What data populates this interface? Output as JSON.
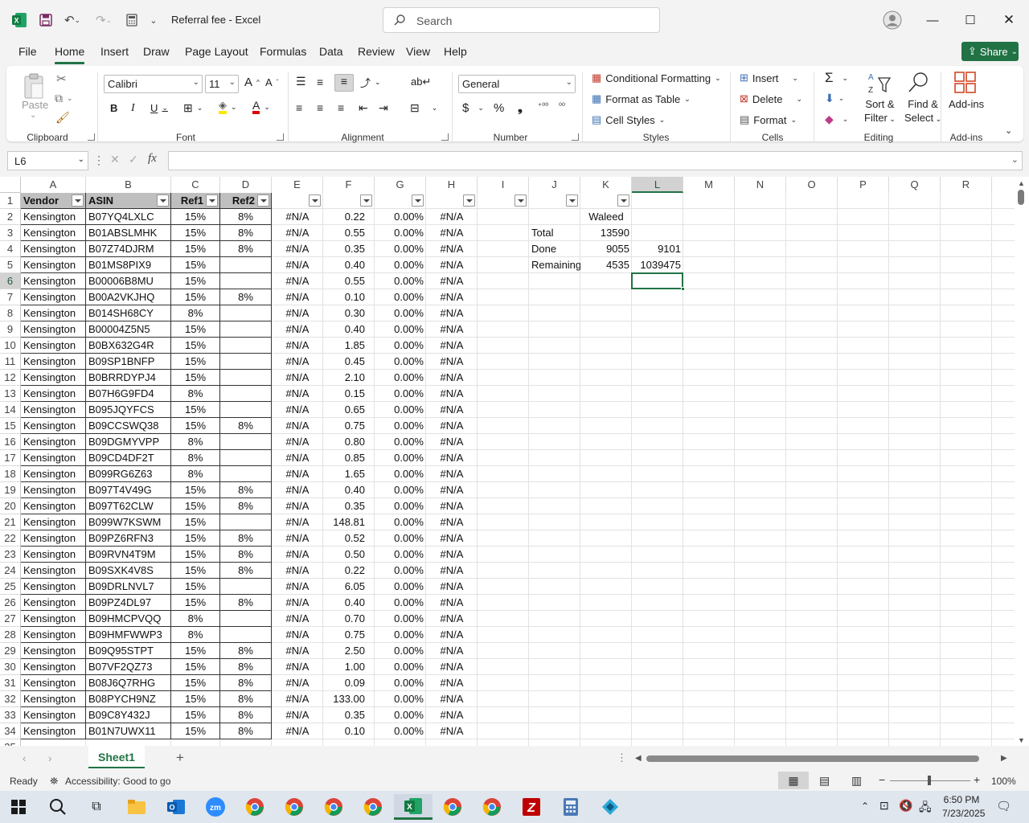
{
  "app": {
    "title": "Referral fee  -  Excel"
  },
  "search": {
    "placeholder": "Search"
  },
  "menu": {
    "tabs": [
      "File",
      "Home",
      "Insert",
      "Draw",
      "Page Layout",
      "Formulas",
      "Data",
      "Review",
      "View",
      "Help"
    ],
    "share": "Share"
  },
  "ribbon": {
    "clipboard": {
      "paste": "Paste",
      "label": "Clipboard"
    },
    "font": {
      "name": "Calibri",
      "size": "11",
      "label": "Font"
    },
    "alignment": {
      "label": "Alignment"
    },
    "number": {
      "format": "General",
      "label": "Number"
    },
    "styles": {
      "conditional": "Conditional Formatting",
      "table": "Format as Table",
      "cellstyles": "Cell Styles",
      "label": "Styles"
    },
    "cells": {
      "insert": "Insert",
      "delete": "Delete",
      "format": "Format",
      "label": "Cells"
    },
    "editing": {
      "sort1": "Sort &",
      "sort2": "Filter",
      "find1": "Find &",
      "find2": "Select",
      "label": "Editing"
    },
    "addins": {
      "btn": "Add-ins",
      "label": "Add-ins"
    }
  },
  "formula_bar": {
    "name_box": "L6",
    "fx": "fx",
    "formula": ""
  },
  "sheet": {
    "columns": [
      "A",
      "B",
      "C",
      "D",
      "E",
      "F",
      "G",
      "H",
      "I",
      "J",
      "K",
      "L",
      "M",
      "N",
      "O",
      "P",
      "Q",
      "R"
    ],
    "selected_column": "L",
    "selected_row": "6",
    "headers": {
      "A": "Vendor",
      "B": "ASIN",
      "C": "Ref1",
      "D": "Ref2"
    },
    "rows": [
      [
        "Kensington",
        "B07YQ4LXLC",
        "15%",
        "8%",
        "#N/A",
        "0.22",
        "0.00%",
        "#N/A"
      ],
      [
        "Kensington",
        "B01ABSLMHK",
        "15%",
        "8%",
        "#N/A",
        "0.55",
        "0.00%",
        "#N/A"
      ],
      [
        "Kensington",
        "B07Z74DJRM",
        "15%",
        "8%",
        "#N/A",
        "0.35",
        "0.00%",
        "#N/A"
      ],
      [
        "Kensington",
        "B01MS8PIX9",
        "15%",
        "",
        "#N/A",
        "0.40",
        "0.00%",
        "#N/A"
      ],
      [
        "Kensington",
        "B00006B8MU",
        "15%",
        "",
        "#N/A",
        "0.55",
        "0.00%",
        "#N/A"
      ],
      [
        "Kensington",
        "B00A2VKJHQ",
        "15%",
        "8%",
        "#N/A",
        "0.10",
        "0.00%",
        "#N/A"
      ],
      [
        "Kensington",
        "B014SH68CY",
        "8%",
        "",
        "#N/A",
        "0.30",
        "0.00%",
        "#N/A"
      ],
      [
        "Kensington",
        "B00004Z5N5",
        "15%",
        "",
        "#N/A",
        "0.40",
        "0.00%",
        "#N/A"
      ],
      [
        "Kensington",
        "B0BX632G4R",
        "15%",
        "",
        "#N/A",
        "1.85",
        "0.00%",
        "#N/A"
      ],
      [
        "Kensington",
        "B09SP1BNFP",
        "15%",
        "",
        "#N/A",
        "0.45",
        "0.00%",
        "#N/A"
      ],
      [
        "Kensington",
        "B0BRRDYPJ4",
        "15%",
        "",
        "#N/A",
        "2.10",
        "0.00%",
        "#N/A"
      ],
      [
        "Kensington",
        "B07H6G9FD4",
        "8%",
        "",
        "#N/A",
        "0.15",
        "0.00%",
        "#N/A"
      ],
      [
        "Kensington",
        "B095JQYFCS",
        "15%",
        "",
        "#N/A",
        "0.65",
        "0.00%",
        "#N/A"
      ],
      [
        "Kensington",
        "B09CCSWQ38",
        "15%",
        "8%",
        "#N/A",
        "0.75",
        "0.00%",
        "#N/A"
      ],
      [
        "Kensington",
        "B09DGMYVPP",
        "8%",
        "",
        "#N/A",
        "0.80",
        "0.00%",
        "#N/A"
      ],
      [
        "Kensington",
        "B09CD4DF2T",
        "8%",
        "",
        "#N/A",
        "0.85",
        "0.00%",
        "#N/A"
      ],
      [
        "Kensington",
        "B099RG6Z63",
        "8%",
        "",
        "#N/A",
        "1.65",
        "0.00%",
        "#N/A"
      ],
      [
        "Kensington",
        "B097T4V49G",
        "15%",
        "8%",
        "#N/A",
        "0.40",
        "0.00%",
        "#N/A"
      ],
      [
        "Kensington",
        "B097T62CLW",
        "15%",
        "8%",
        "#N/A",
        "0.35",
        "0.00%",
        "#N/A"
      ],
      [
        "Kensington",
        "B099W7KSWM",
        "15%",
        "",
        "#N/A",
        "148.81",
        "0.00%",
        "#N/A"
      ],
      [
        "Kensington",
        "B09PZ6RFN3",
        "15%",
        "8%",
        "#N/A",
        "0.52",
        "0.00%",
        "#N/A"
      ],
      [
        "Kensington",
        "B09RVN4T9M",
        "15%",
        "8%",
        "#N/A",
        "0.50",
        "0.00%",
        "#N/A"
      ],
      [
        "Kensington",
        "B09SXK4V8S",
        "15%",
        "8%",
        "#N/A",
        "0.22",
        "0.00%",
        "#N/A"
      ],
      [
        "Kensington",
        "B09DRLNVL7",
        "15%",
        "",
        "#N/A",
        "6.05",
        "0.00%",
        "#N/A"
      ],
      [
        "Kensington",
        "B09PZ4DL97",
        "15%",
        "8%",
        "#N/A",
        "0.40",
        "0.00%",
        "#N/A"
      ],
      [
        "Kensington",
        "B09HMCPVQQ",
        "8%",
        "",
        "#N/A",
        "0.70",
        "0.00%",
        "#N/A"
      ],
      [
        "Kensington",
        "B09HMFWWP3",
        "8%",
        "",
        "#N/A",
        "0.75",
        "0.00%",
        "#N/A"
      ],
      [
        "Kensington",
        "B09Q95STPT",
        "15%",
        "8%",
        "#N/A",
        "2.50",
        "0.00%",
        "#N/A"
      ],
      [
        "Kensington",
        "B07VF2QZ73",
        "15%",
        "8%",
        "#N/A",
        "1.00",
        "0.00%",
        "#N/A"
      ],
      [
        "Kensington",
        "B08J6Q7RHG",
        "15%",
        "8%",
        "#N/A",
        "0.09",
        "0.00%",
        "#N/A"
      ],
      [
        "Kensington",
        "B08PYCH9NZ",
        "15%",
        "8%",
        "#N/A",
        "133.00",
        "0.00%",
        "#N/A"
      ],
      [
        "Kensington",
        "B09C8Y432J",
        "15%",
        "8%",
        "#N/A",
        "0.35",
        "0.00%",
        "#N/A"
      ],
      [
        "Kensington",
        "B01N7UWX11",
        "15%",
        "8%",
        "#N/A",
        "0.10",
        "0.00%",
        "#N/A"
      ]
    ],
    "side": {
      "K2": "Waleed",
      "J3": "Total",
      "K3": "13590",
      "J4": "Done",
      "K4": "9055",
      "L4": "9101",
      "J5": "Remaining",
      "K5": "4535",
      "L5": "1039475"
    },
    "tab": "Sheet1"
  },
  "status": {
    "ready": "Ready",
    "accessibility": "Accessibility: Good to go",
    "zoom": "100%"
  },
  "taskbar": {
    "time": "6:50 PM",
    "date": "7/23/2025"
  },
  "colors": {
    "accent": "#217346",
    "header_fill": "#bfbfbf"
  }
}
